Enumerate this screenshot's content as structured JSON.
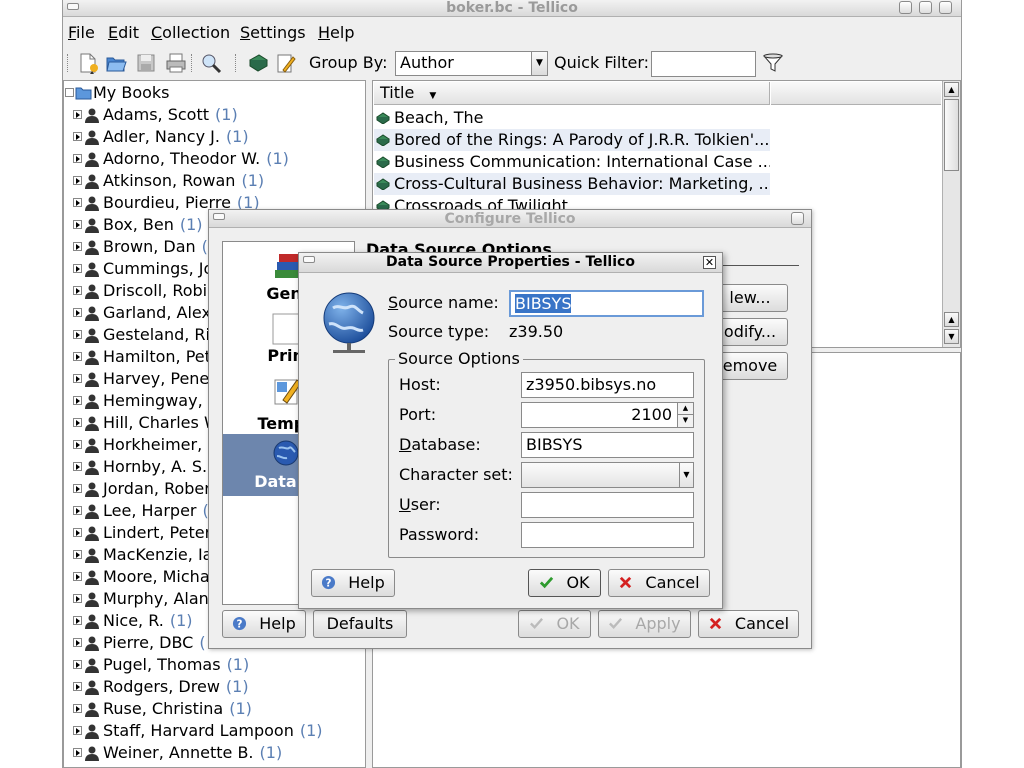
{
  "window": {
    "title": "boker.bc - Tellico",
    "menus": [
      "File",
      "Edit",
      "Collection",
      "Settings",
      "Help"
    ]
  },
  "toolbar": {
    "group_by_label": "Group By:",
    "group_by_value": "Author",
    "quick_filter_label": "Quick Filter:",
    "quick_filter_value": "",
    "icons": [
      "new-collection-icon",
      "open-icon",
      "save-icon",
      "print-icon",
      "search-icon",
      "bookmark-icon",
      "edit-entry-icon",
      "filter-icon"
    ]
  },
  "tree": {
    "root": "My Books",
    "items": [
      {
        "name": "Adams, Scott",
        "count": "(1)"
      },
      {
        "name": "Adler, Nancy J.",
        "count": "(1)"
      },
      {
        "name": "Adorno, Theodor W.",
        "count": "(1)"
      },
      {
        "name": "Atkinson, Rowan",
        "count": "(1)"
      },
      {
        "name": "Bourdieu, Pierre",
        "count": "(1)"
      },
      {
        "name": "Box, Ben",
        "count": "(1)"
      },
      {
        "name": "Brown, Dan",
        "count": "(1)"
      },
      {
        "name": "Cummings, Jo",
        "count": ""
      },
      {
        "name": "Driscoll, Robin",
        "count": ""
      },
      {
        "name": "Garland, Alex",
        "count": ""
      },
      {
        "name": "Gesteland, Ric",
        "count": ""
      },
      {
        "name": "Hamilton, Pete",
        "count": ""
      },
      {
        "name": "Harvey, Penel",
        "count": ""
      },
      {
        "name": "Hemingway, E",
        "count": ""
      },
      {
        "name": "Hill, Charles W",
        "count": ""
      },
      {
        "name": "Horkheimer, M",
        "count": ""
      },
      {
        "name": "Hornby, A. S.",
        "count": ""
      },
      {
        "name": "Jordan, Rober",
        "count": ""
      },
      {
        "name": "Lee, Harper",
        "count": "("
      },
      {
        "name": "Lindert, Peter",
        "count": ""
      },
      {
        "name": "MacKenzie, Ia",
        "count": ""
      },
      {
        "name": "Moore, Michae",
        "count": ""
      },
      {
        "name": "Murphy, Alan",
        "count": ""
      },
      {
        "name": "Nice, R.",
        "count": "(1)"
      },
      {
        "name": "Pierre, DBC",
        "count": "("
      },
      {
        "name": "Pugel, Thomas",
        "count": "(1)"
      },
      {
        "name": "Rodgers, Drew",
        "count": "(1)"
      },
      {
        "name": "Ruse, Christina",
        "count": "(1)"
      },
      {
        "name": "Staff, Harvard Lampoon",
        "count": "(1)"
      },
      {
        "name": "Weiner, Annette B.",
        "count": "(1)"
      }
    ]
  },
  "list": {
    "column_title": "Title",
    "rows": [
      "Beach, The",
      "Bored of the Rings: A Parody of J.R.R. Tolkien'...",
      "Business Communication: International Case ...",
      "Cross-Cultural Business Behavior: Marketing, ...",
      "Crossroads of Twilight"
    ]
  },
  "configure": {
    "title": "Configure Tellico",
    "section_title": "Data Source Options",
    "pages": [
      {
        "label": "Gene",
        "icon": "books-icon"
      },
      {
        "label": "Print",
        "icon": "print-page-icon"
      },
      {
        "label": "Templa",
        "icon": "template-icon"
      },
      {
        "label": "Data So",
        "icon": "globe-icon"
      }
    ],
    "side_buttons": [
      "New...",
      "Modify...",
      "Remove"
    ],
    "side_buttons_visible": [
      "lew...",
      "odify...",
      "emove"
    ],
    "help": "Help",
    "defaults": "Defaults",
    "ok": "OK",
    "apply": "Apply",
    "cancel": "Cancel"
  },
  "dsp": {
    "title": "Data Source Properties - Tellico",
    "source_name_label": "Source name:",
    "source_name_value": "BIBSYS",
    "source_type_label": "Source type:",
    "source_type_value": "z39.50",
    "group_title": "Source Options",
    "host_label": "Host:",
    "host_value": "z3950.bibsys.no",
    "port_label": "Port:",
    "port_value": "2100",
    "database_label": "Database:",
    "database_value": "BIBSYS",
    "charset_label": "Character set:",
    "charset_value": "",
    "user_label": "User:",
    "user_value": "",
    "password_label": "Password:",
    "password_value": "",
    "help": "Help",
    "ok": "OK",
    "cancel": "Cancel"
  },
  "colors": {
    "selection": "#6d86ad",
    "count_text": "#5b7fb3",
    "alt_row": "#e8edf6",
    "ok_green": "#2e9b2e",
    "cancel_red": "#d42020"
  }
}
